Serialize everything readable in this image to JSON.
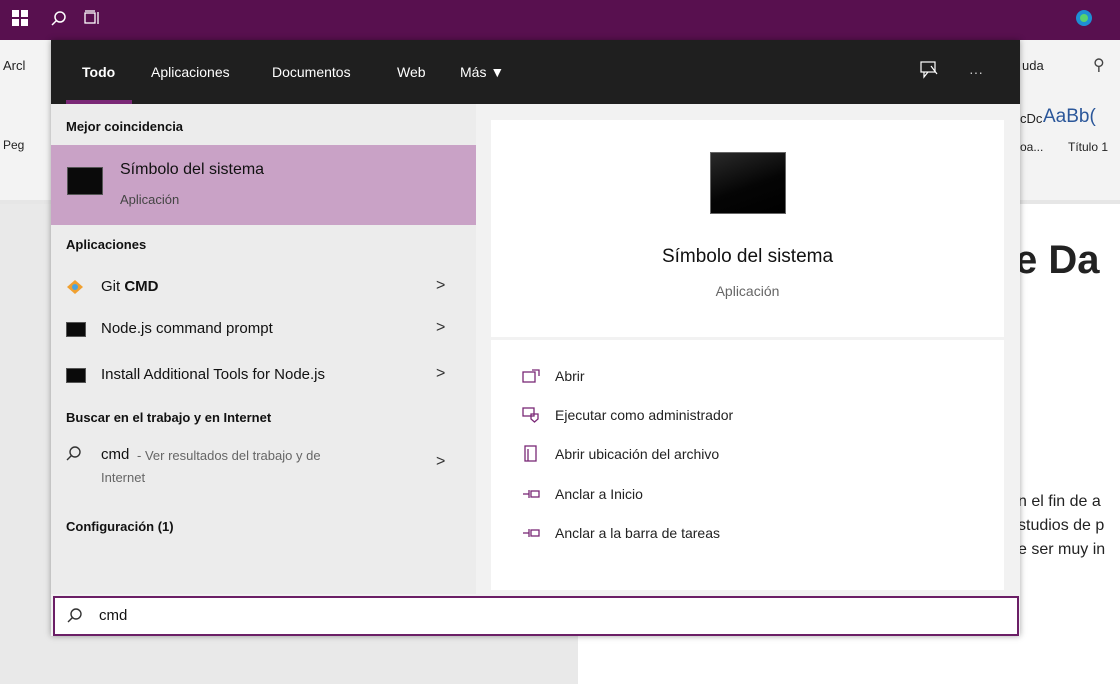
{
  "taskbar": {
    "windows_icon": "windows-logo-icon",
    "search_icon": "search-icon",
    "taskview_icon": "task-view-icon",
    "edge_icon": "edge-icon"
  },
  "background_doc": {
    "tab_left_partial": "Arcl",
    "tab_right_partial": "uda",
    "paste_partial": "Peg",
    "style1_preview": "cDc",
    "style2_preview": "AaBb(",
    "style1_name": "oa...",
    "style2_name": "Título 1",
    "heading_partial": "e Da",
    "body_line1": "n el fin de a",
    "body_line2": "studios de p",
    "body_line3": "e ser muy in"
  },
  "header": {
    "tabs": [
      "Todo",
      "Aplicaciones",
      "Documentos",
      "Web",
      "Más ▼"
    ],
    "feedback_icon": "feedback-icon",
    "more_icon": "more-icon",
    "more_label": "···"
  },
  "left": {
    "best_match_heading": "Mejor coincidencia",
    "best_match": {
      "title": "Símbolo del sistema",
      "subtitle": "Aplicación"
    },
    "apps_heading": "Aplicaciones",
    "apps": [
      {
        "label_pre": "Git ",
        "label_bold": "CMD",
        "icon": "git-icon"
      },
      {
        "label": "Node.js command prompt",
        "icon": "console-icon"
      },
      {
        "label": "Install Additional Tools for Node.js",
        "icon": "console-icon"
      }
    ],
    "web_heading": "Buscar en el trabajo y en Internet",
    "web_query": "cmd",
    "web_suffix": " - Ver resultados del trabajo y de",
    "web_suffix2": "Internet",
    "settings_heading": "Configuración (1)",
    "chevron": ">"
  },
  "right": {
    "app_title": "Símbolo del sistema",
    "app_subtitle": "Aplicación",
    "actions": [
      {
        "label": "Abrir",
        "icon": "open-icon"
      },
      {
        "label": "Ejecutar como administrador",
        "icon": "run-as-admin-icon"
      },
      {
        "label": "Abrir ubicación del archivo",
        "icon": "file-location-icon"
      },
      {
        "label": "Anclar a Inicio",
        "icon": "pin-icon"
      },
      {
        "label": "Anclar a la barra de tareas",
        "icon": "pin-icon"
      }
    ]
  },
  "search": {
    "value": "cmd"
  },
  "colors": {
    "accent": "#7a2876",
    "highlight": "#c9a2c6",
    "taskbar": "#58104f"
  }
}
